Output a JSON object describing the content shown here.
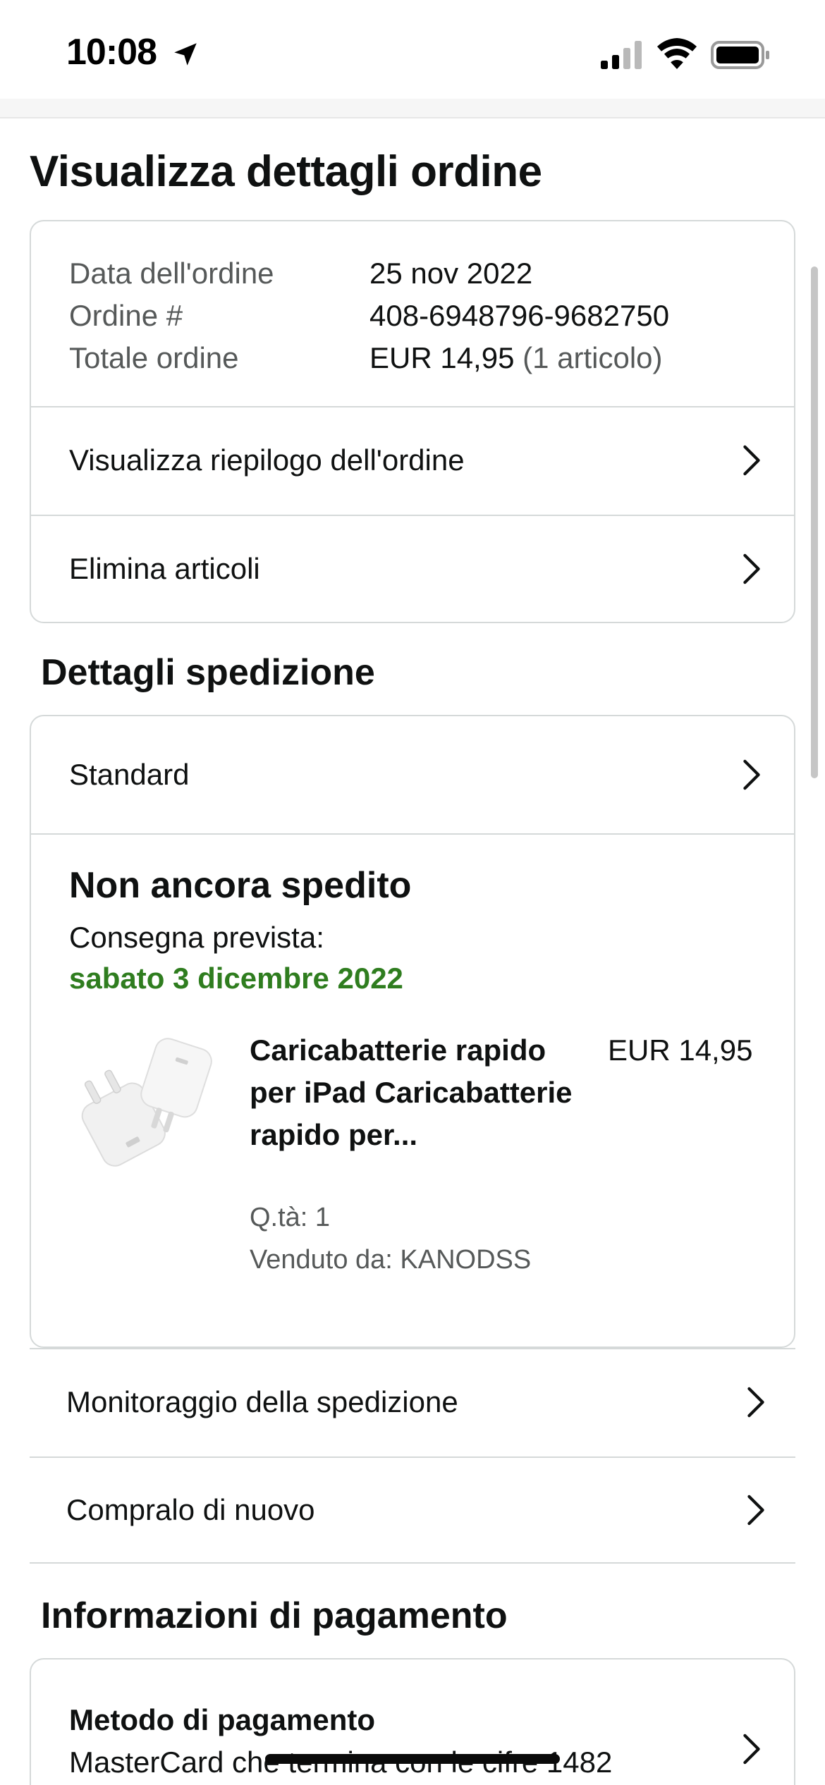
{
  "status_bar": {
    "time": "10:08",
    "icons": [
      "location-arrow-icon",
      "cellular-signal-icon",
      "wifi-icon",
      "battery-icon"
    ]
  },
  "page": {
    "title": "Visualizza dettagli ordine"
  },
  "order_summary": {
    "date_label": "Data dell'ordine",
    "date_value": "25 nov 2022",
    "number_label": "Ordine #",
    "number_value": "408-6948796-9682750",
    "total_label": "Totale ordine",
    "total_value": "EUR 14,95",
    "total_items": "(1 articolo)",
    "links": [
      {
        "label": "Visualizza riepilogo dell'ordine"
      },
      {
        "label": "Elimina articoli"
      }
    ]
  },
  "shipping": {
    "section_title": "Dettagli spedizione",
    "method": "Standard",
    "status": "Non ancora spedito",
    "eta_label": "Consegna prevista:",
    "eta_date": "sabato 3 dicembre 2022",
    "product": {
      "title": "Caricabatterie rapido per iPad Caricabatterie rapido per...",
      "price": "EUR 14,95",
      "qty": "Q.tà: 1",
      "seller": "Venduto da: KANODSS"
    },
    "actions": [
      {
        "label": "Monitoraggio della spedizione"
      },
      {
        "label": "Compralo di nuovo"
      }
    ]
  },
  "payment": {
    "section_title": "Informazioni di pagamento",
    "method_label": "Metodo di pagamento",
    "method_detail": "MasterCard che termina con le cifre 1482"
  },
  "colors": {
    "eta_green": "#2f7d1f",
    "border": "#d5d9d9",
    "muted_text": "#565959"
  }
}
